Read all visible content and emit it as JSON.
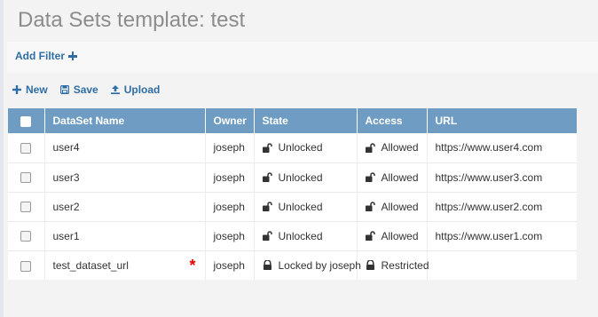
{
  "page": {
    "title": "Data Sets template: test"
  },
  "filter": {
    "add_label": "Add Filter"
  },
  "toolbar": {
    "new_label": "New",
    "save_label": "Save",
    "upload_label": "Upload"
  },
  "table": {
    "columns": {
      "name": "DataSet Name",
      "owner": "Owner",
      "state": "State",
      "access": "Access",
      "url": "URL"
    },
    "rows": [
      {
        "name": "user4",
        "owner": "joseph",
        "state": "Unlocked",
        "access": "Allowed",
        "url": "https://www.user4.com",
        "state_icon": "unlock-icon",
        "access_icon": "unlock-icon",
        "required": false
      },
      {
        "name": "user3",
        "owner": "joseph",
        "state": "Unlocked",
        "access": "Allowed",
        "url": "https://www.user3.com",
        "state_icon": "unlock-icon",
        "access_icon": "unlock-icon",
        "required": false
      },
      {
        "name": "user2",
        "owner": "joseph",
        "state": "Unlocked",
        "access": "Allowed",
        "url": "https://www.user2.com",
        "state_icon": "unlock-icon",
        "access_icon": "unlock-icon",
        "required": false
      },
      {
        "name": "user1",
        "owner": "joseph",
        "state": "Unlocked",
        "access": "Allowed",
        "url": "https://www.user1.com",
        "state_icon": "unlock-icon",
        "access_icon": "unlock-icon",
        "required": false
      },
      {
        "name": "test_dataset_url",
        "owner": "joseph",
        "state": "Locked by joseph",
        "access": "Restricted",
        "url": "",
        "state_icon": "lock-icon",
        "access_icon": "lock-icon",
        "required": true,
        "required_mark": "*"
      }
    ]
  },
  "colors": {
    "accent": "#2f6ea5",
    "header_bg": "#6f9cc2",
    "required": "#e00000",
    "title": "#8c8c8c"
  }
}
